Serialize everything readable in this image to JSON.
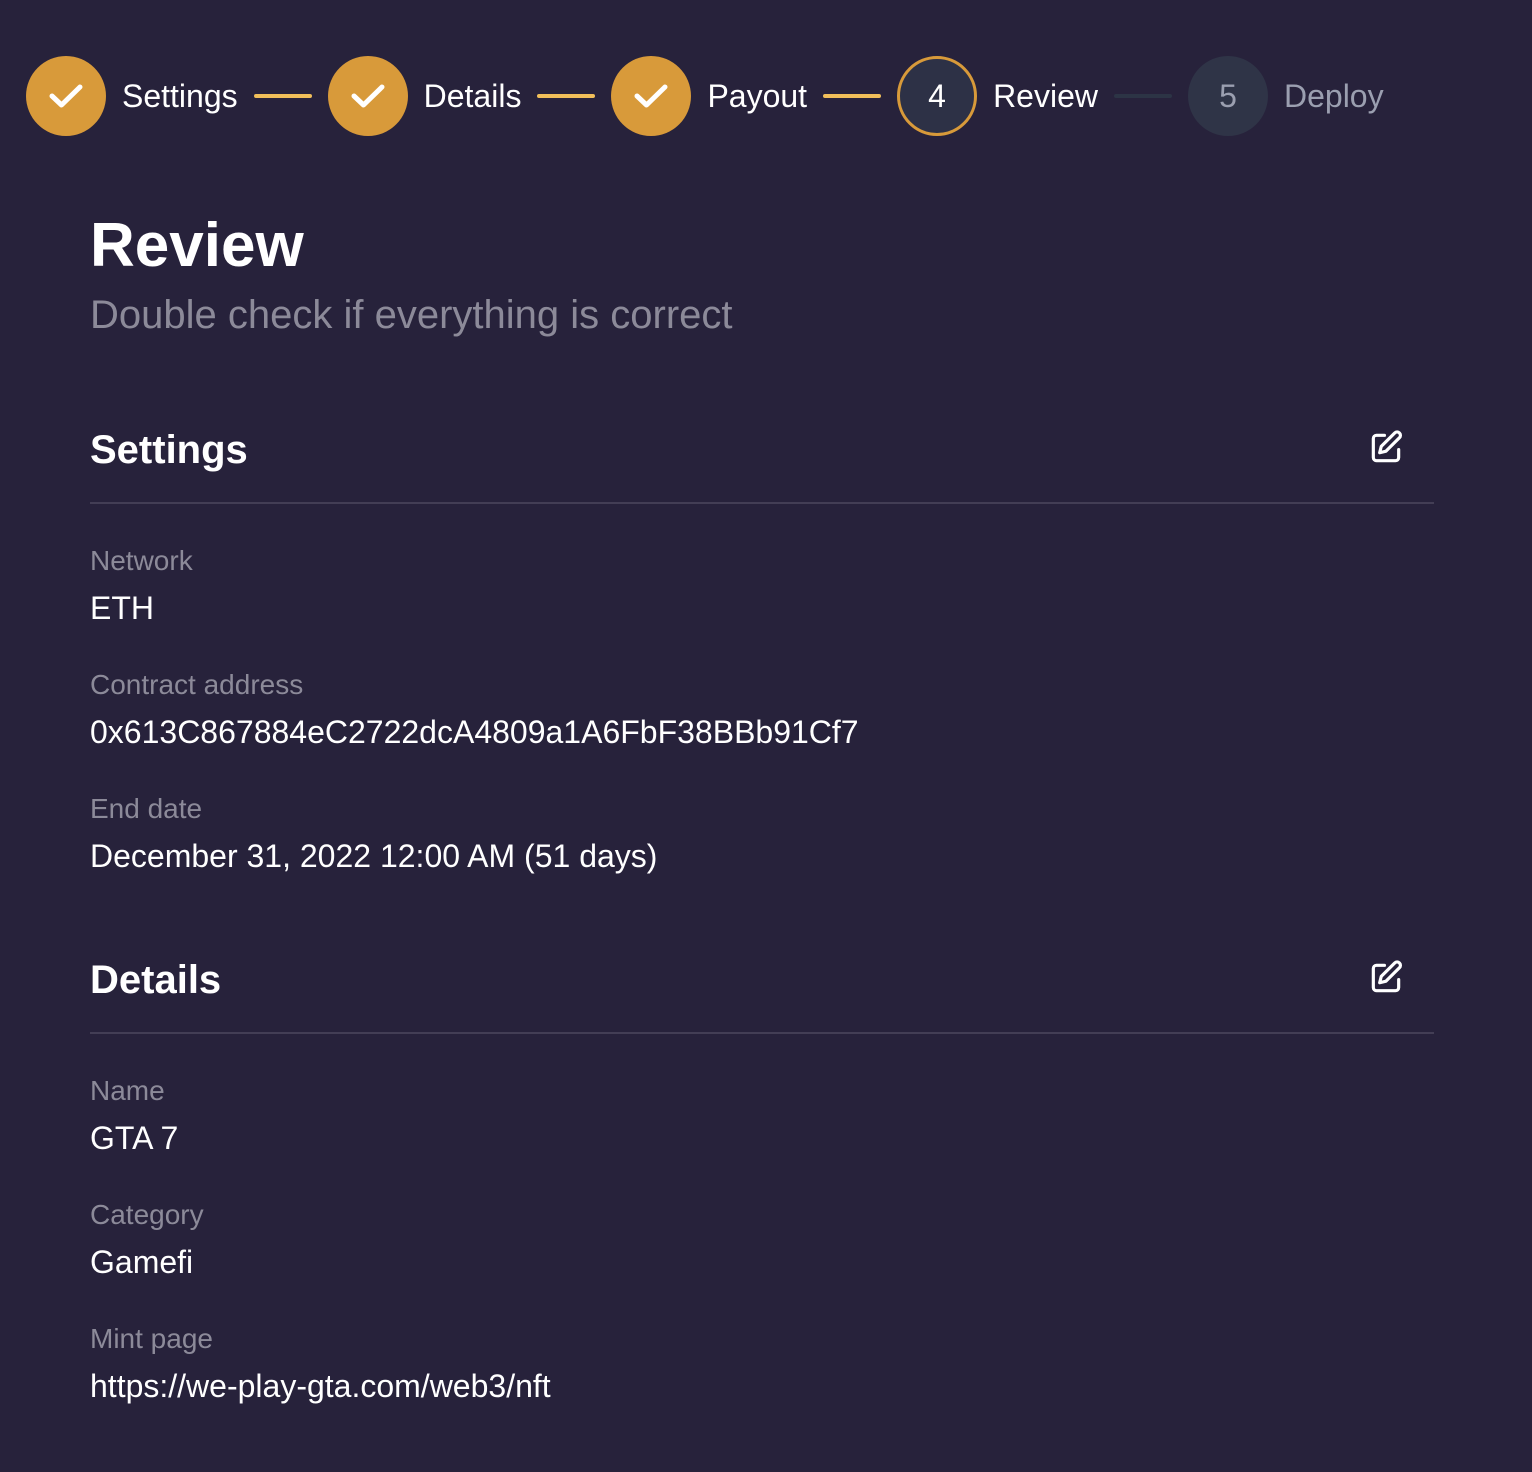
{
  "stepper": {
    "steps": [
      {
        "label": "Settings",
        "number": "1",
        "status": "done"
      },
      {
        "label": "Details",
        "number": "2",
        "status": "done"
      },
      {
        "label": "Payout",
        "number": "3",
        "status": "done"
      },
      {
        "label": "Review",
        "number": "4",
        "status": "current"
      },
      {
        "label": "Deploy",
        "number": "5",
        "status": "upcoming"
      }
    ],
    "icons": {
      "done": "check-icon"
    }
  },
  "header": {
    "title": "Review",
    "subtitle": "Double check if everything is correct"
  },
  "sections": {
    "settings": {
      "title": "Settings",
      "edit_icon": "edit-icon",
      "fields": [
        {
          "label": "Network",
          "value": "ETH"
        },
        {
          "label": "Contract address",
          "value": "0x613C867884eC2722dcA4809a1A6FbF38BBb91Cf7"
        },
        {
          "label": "End date",
          "value": "December 31, 2022 12:00 AM (51 days)"
        }
      ]
    },
    "details": {
      "title": "Details",
      "edit_icon": "edit-icon",
      "fields": [
        {
          "label": "Name",
          "value": "GTA 7"
        },
        {
          "label": "Category",
          "value": "Gamefi"
        },
        {
          "label": "Mint page",
          "value": "https://we-play-gta.com/web3/nft"
        }
      ]
    }
  },
  "colors": {
    "background": "#27223b",
    "accent": "#d89a3a",
    "connector_active": "#f1bf5a",
    "connector_inactive": "#2c3445",
    "muted_text": "#8c8a99",
    "divider": "#433e55"
  }
}
